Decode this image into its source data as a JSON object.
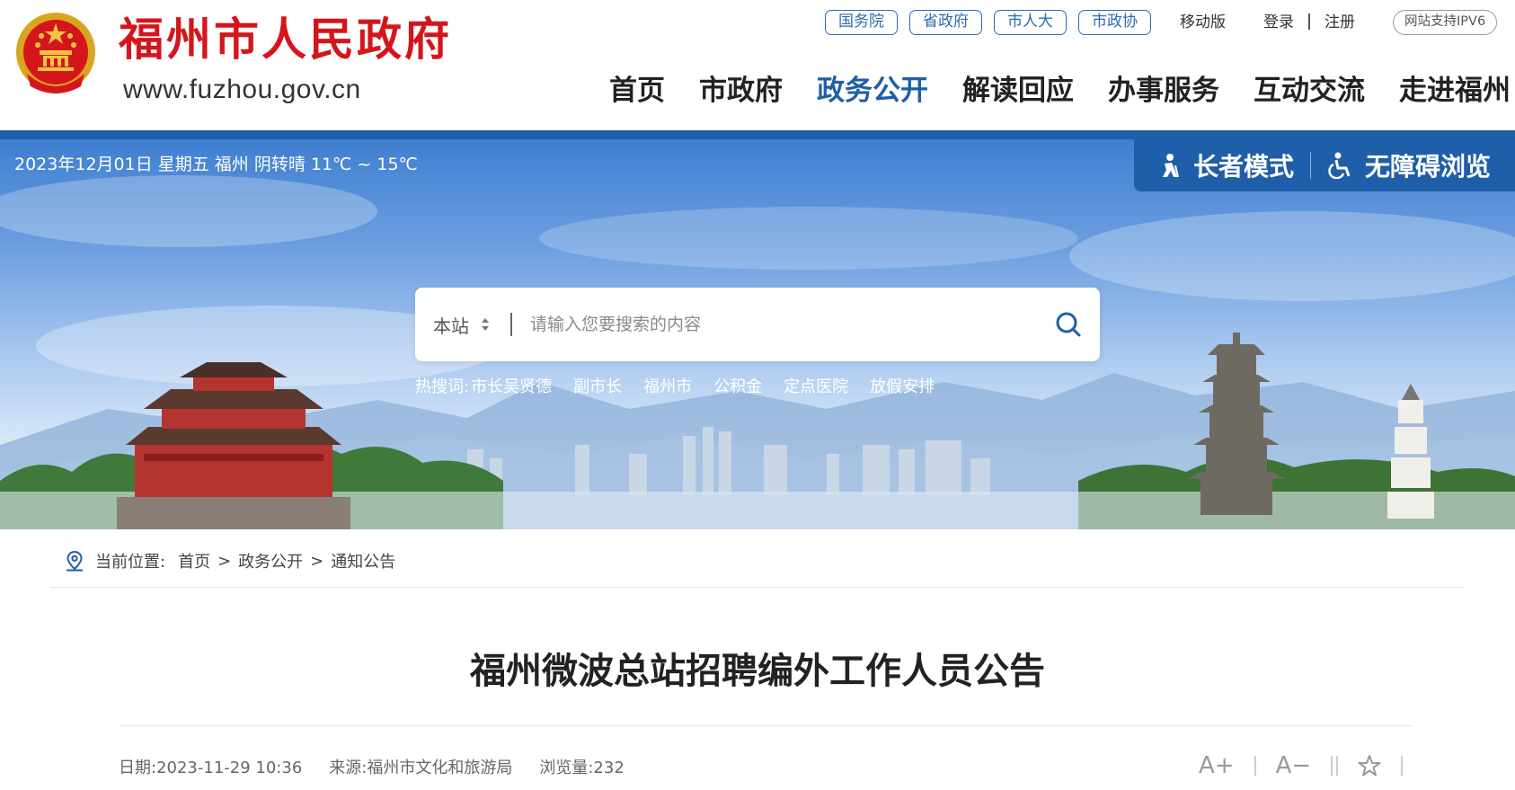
{
  "header": {
    "site_name": "福州市人民政府",
    "site_url": "www.fuzhou.gov.cn",
    "top_links": [
      "国务院",
      "省政府",
      "市人大",
      "市政协"
    ],
    "mobile": "移动版",
    "login": "登录",
    "register": "注册",
    "ipv6": "网站支持IPV6",
    "nav": [
      {
        "label": "首页",
        "active": false
      },
      {
        "label": "市政府",
        "active": false
      },
      {
        "label": "政务公开",
        "active": true
      },
      {
        "label": "解读回应",
        "active": false
      },
      {
        "label": "办事服务",
        "active": false
      },
      {
        "label": "互动交流",
        "active": false
      },
      {
        "label": "走进福州",
        "active": false
      }
    ]
  },
  "banner": {
    "date_weather": "2023年12月01日  星期五   福州  阴转晴  11℃ ~ 15℃",
    "elder_mode": "长者模式",
    "accessible": "无障碍浏览",
    "search": {
      "scope": "本站",
      "placeholder": "请输入您要搜索的内容"
    },
    "hot_label": "热搜词:",
    "hot_words": [
      "市长吴贤德",
      "副市长",
      "福州市",
      "公积金",
      "定点医院",
      "放假安排"
    ]
  },
  "breadcrumb": {
    "label": "当前位置:",
    "items": [
      "首页",
      "政务公开",
      "通知公告"
    ],
    "separator": ">"
  },
  "article": {
    "title": "福州微波总站招聘编外工作人员公告",
    "date": "日期:2023-11-29 10:36",
    "source": "来源:福州市文化和旅游局",
    "views": "浏览量:232",
    "font_increase": "A+",
    "font_decrease": "A−"
  },
  "colors": {
    "brand_red": "#d4161c",
    "brand_blue": "#1f5ea8",
    "nav_active": "#1f5fa6"
  }
}
